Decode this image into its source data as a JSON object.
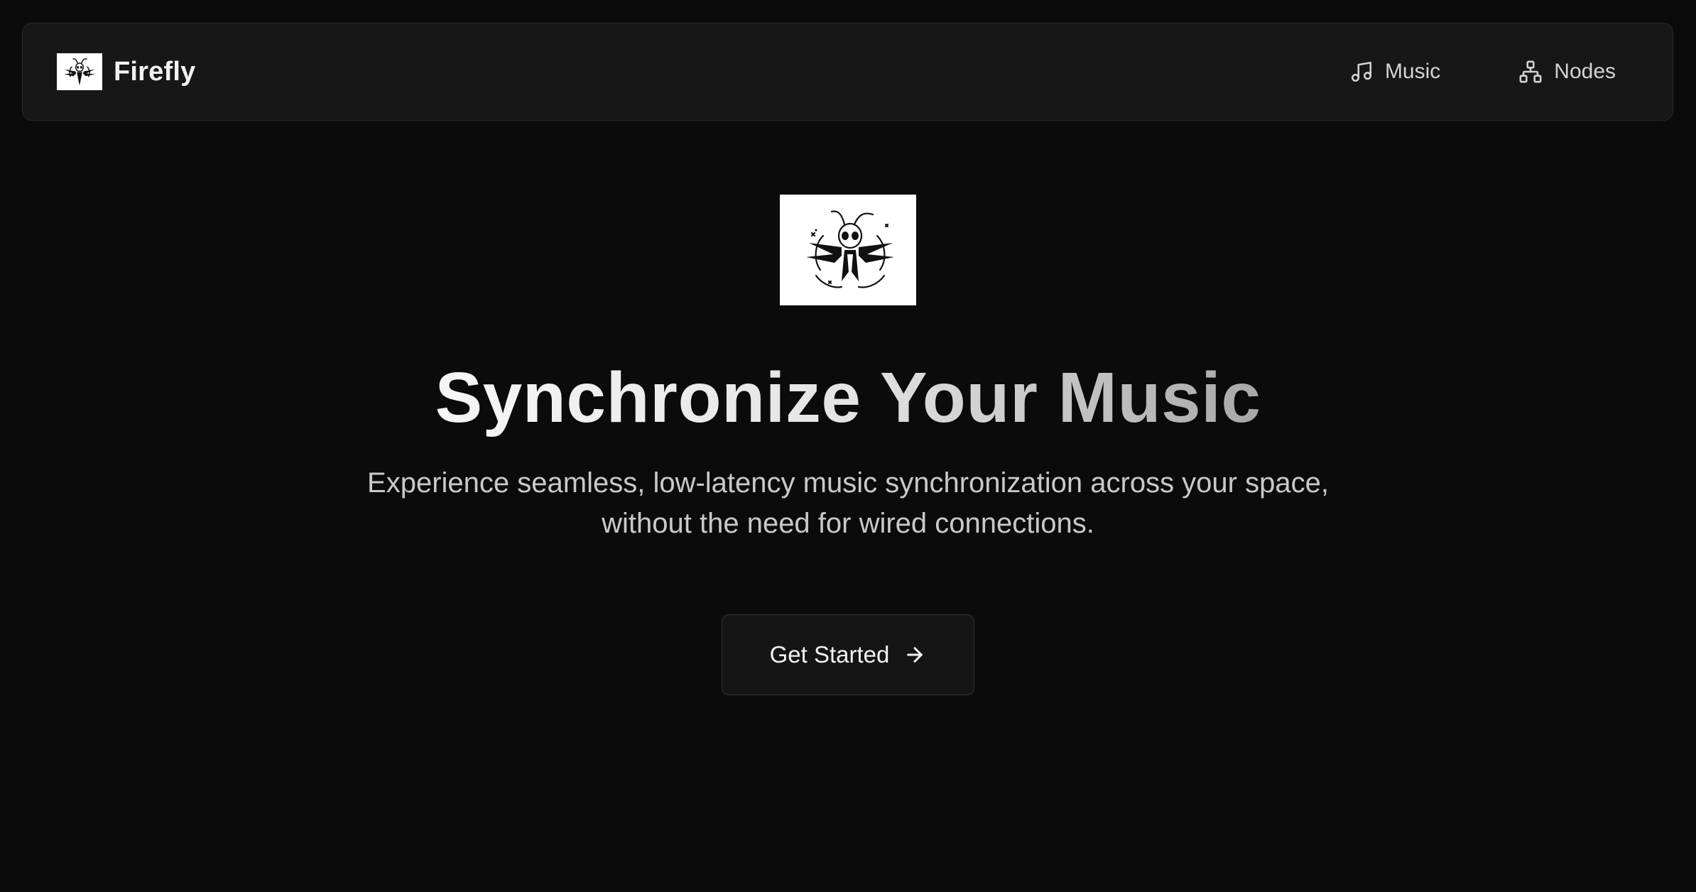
{
  "navbar": {
    "brand_name": "Firefly",
    "logo_icon": "firefly-logo-icon",
    "links": [
      {
        "label": "Music",
        "icon": "music-note-icon"
      },
      {
        "label": "Nodes",
        "icon": "network-nodes-icon"
      }
    ]
  },
  "hero": {
    "logo_icon": "firefly-logo-icon",
    "title": "Synchronize Your Music",
    "subtitle": "Experience seamless, low-latency music synchronization across your space, without the need for wired connections.",
    "cta_label": "Get Started",
    "cta_icon": "arrow-right-icon"
  },
  "colors": {
    "background": "#0b0b0b",
    "navbar_bg": "#171717",
    "border": "#2b2b2b",
    "text_primary": "#f2f2f2",
    "text_secondary": "#c9c9c9"
  }
}
